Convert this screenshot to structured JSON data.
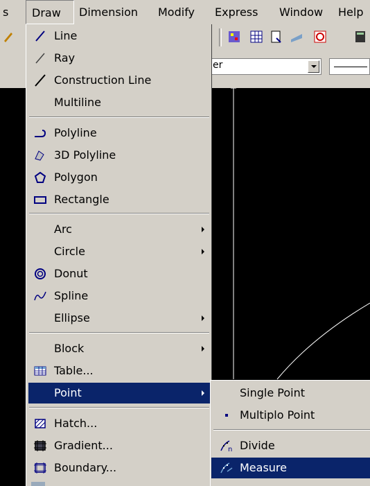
{
  "menubar": {
    "items": [
      "s",
      "Draw",
      "Dimension",
      "Modify",
      "Express",
      "Window",
      "Help"
    ]
  },
  "toolbar": {
    "layer_fragment": "er"
  },
  "draw_menu": {
    "items": [
      {
        "label": "Line",
        "icon": "line-icon"
      },
      {
        "label": "Ray",
        "icon": "ray-icon"
      },
      {
        "label": "Construction Line",
        "icon": "construction-line-icon"
      },
      {
        "label": "Multiline",
        "icon": ""
      },
      {
        "label": "Polyline",
        "icon": "polyline-icon"
      },
      {
        "label": "3D Polyline",
        "icon": "3d-polyline-icon"
      },
      {
        "label": "Polygon",
        "icon": "polygon-icon"
      },
      {
        "label": "Rectangle",
        "icon": "rectangle-icon"
      },
      {
        "label": "Arc",
        "icon": "",
        "submenu": true
      },
      {
        "label": "Circle",
        "icon": "",
        "submenu": true
      },
      {
        "label": "Donut",
        "icon": "donut-icon"
      },
      {
        "label": "Spline",
        "icon": "spline-icon"
      },
      {
        "label": "Ellipse",
        "icon": "",
        "submenu": true
      },
      {
        "label": "Block",
        "icon": "",
        "submenu": true
      },
      {
        "label": "Table...",
        "icon": "table-icon"
      },
      {
        "label": "Point",
        "icon": "",
        "submenu": true,
        "highlighted": true
      },
      {
        "label": "Hatch...",
        "icon": "hatch-icon"
      },
      {
        "label": "Gradient...",
        "icon": "gradient-icon"
      },
      {
        "label": "Boundary...",
        "icon": "boundary-icon"
      }
    ]
  },
  "point_submenu": {
    "items": [
      {
        "label": "Single Point",
        "icon": ""
      },
      {
        "label": "Multiplo Point",
        "icon": "point-icon"
      },
      {
        "label": "Divide",
        "icon": "divide-icon"
      },
      {
        "label": "Measure",
        "icon": "measure-icon",
        "highlighted": true
      }
    ]
  },
  "colors": {
    "menu_bg": "#d4d0c8",
    "highlight": "#0a246a",
    "canvas": "#000000"
  }
}
